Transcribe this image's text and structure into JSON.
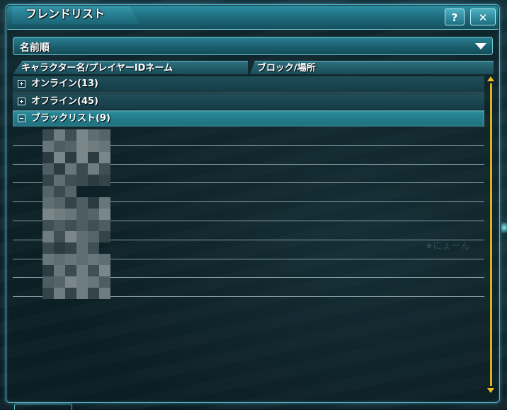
{
  "window": {
    "title": "フレンドリスト",
    "help_label": "?",
    "close_label": "✕"
  },
  "sort_dropdown": {
    "selected": "名前順",
    "arrow_icon": "triangle-down-icon"
  },
  "columns": [
    {
      "label": "キャラクター名/プレイヤーIDネーム"
    },
    {
      "label": "ブロック/場所"
    }
  ],
  "groups": [
    {
      "label": "オンライン(13)",
      "state": "collapsed",
      "toggle_icon": "plus-box-icon"
    },
    {
      "label": "オフライン(45)",
      "state": "collapsed",
      "toggle_icon": "plus-box-icon"
    },
    {
      "label": "ブラックリスト(9)",
      "state": "expanded",
      "toggle_icon": "minus-box-icon"
    }
  ],
  "blacklist_entries": [
    {
      "name": "",
      "blurred": true
    },
    {
      "name": "",
      "blurred": true
    },
    {
      "name": "",
      "blurred": true
    },
    {
      "name": "",
      "blurred": true
    },
    {
      "name": "",
      "blurred": true
    },
    {
      "name": "",
      "blurred": true
    },
    {
      "name": "",
      "blurred": true
    },
    {
      "name": "",
      "blurred": true
    },
    {
      "name": "",
      "blurred": true
    }
  ],
  "background_text": "★にょーん",
  "colors": {
    "accent": "#5fb8cc",
    "selected_row": "#2a8a98",
    "scroll": "#f0c020"
  }
}
